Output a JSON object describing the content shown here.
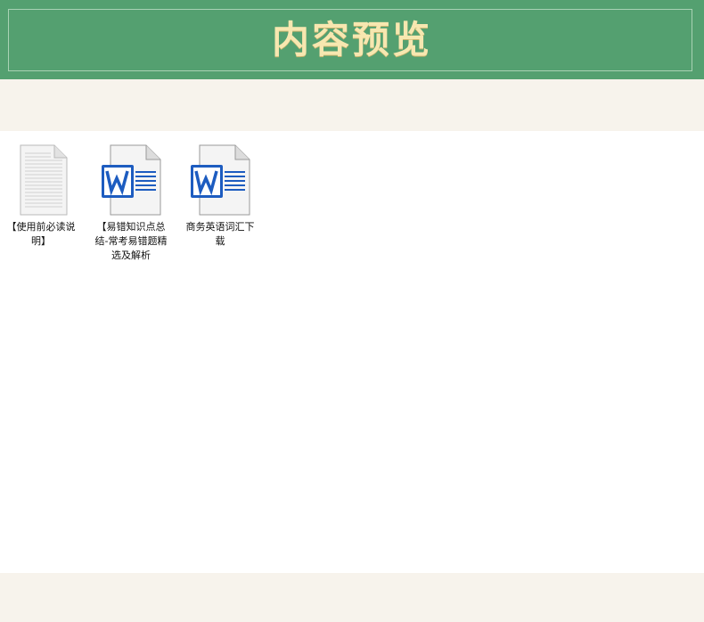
{
  "header": {
    "title": "内容预览"
  },
  "files": [
    {
      "name": "【使用前必读说明】",
      "icon": "text-document-icon"
    },
    {
      "name": "【易错知识点总结-常考易错题精选及解析",
      "icon": "word-document-icon"
    },
    {
      "name": "商务英语词汇下载",
      "icon": "word-document-icon"
    }
  ],
  "colors": {
    "header_green": "#54a070",
    "title_gold": "#f7e7b0",
    "beige": "#f7f3ec",
    "word_blue": "#1d5cc0"
  }
}
